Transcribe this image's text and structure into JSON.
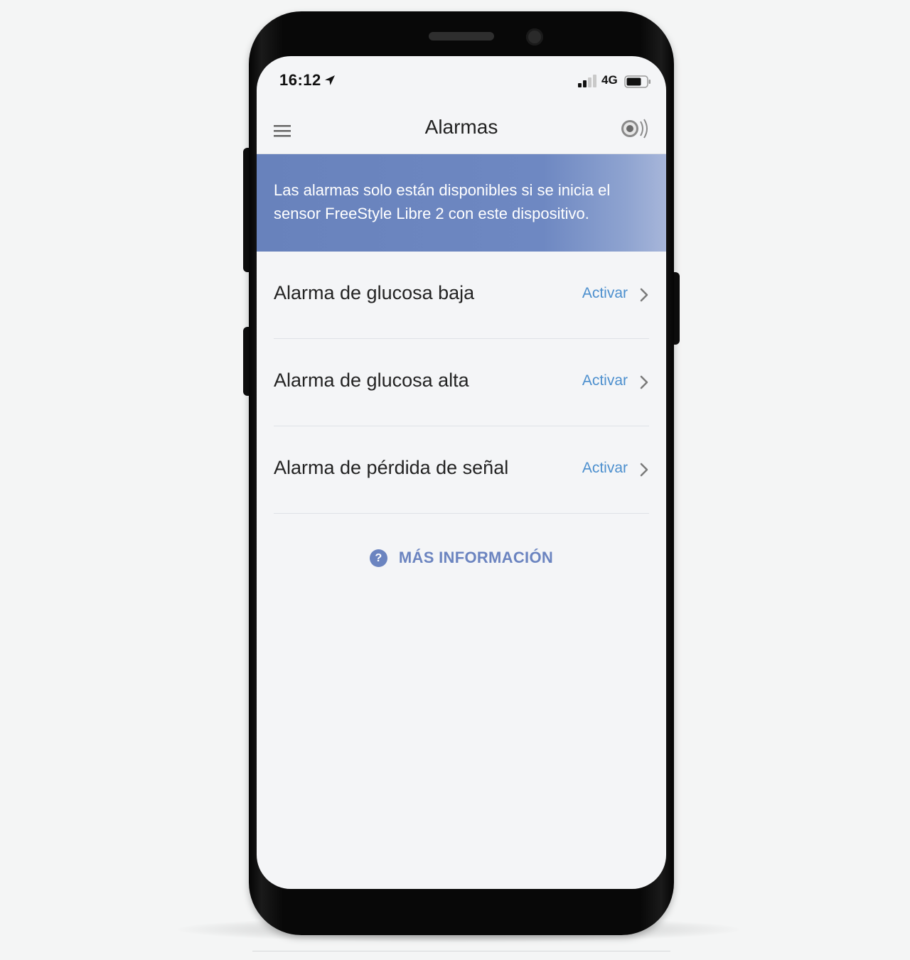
{
  "status_bar": {
    "time": "16:12",
    "network": "4G",
    "icons": [
      "location-arrow-icon",
      "signal-icon",
      "battery-icon"
    ]
  },
  "nav": {
    "title": "Alarmas",
    "left_icon": "hamburger-menu-icon",
    "right_icon": "sensor-icon"
  },
  "banner": {
    "text": "Las alarmas solo están disponibles si se inicia el sensor FreeStyle Libre 2 con este dispositivo."
  },
  "alarms": [
    {
      "label": "Alarma de glucosa baja",
      "action": "Activar"
    },
    {
      "label": "Alarma de glucosa alta",
      "action": "Activar"
    },
    {
      "label": "Alarma de pérdida de señal",
      "action": "Activar"
    }
  ],
  "info_link": {
    "icon_glyph": "?",
    "label": "MÁS INFORMACIÓN"
  },
  "colors": {
    "banner": "#6e88c2",
    "accent_link": "#4c8fce",
    "info": "#6b84c0",
    "screen_bg": "#f4f5f7"
  }
}
